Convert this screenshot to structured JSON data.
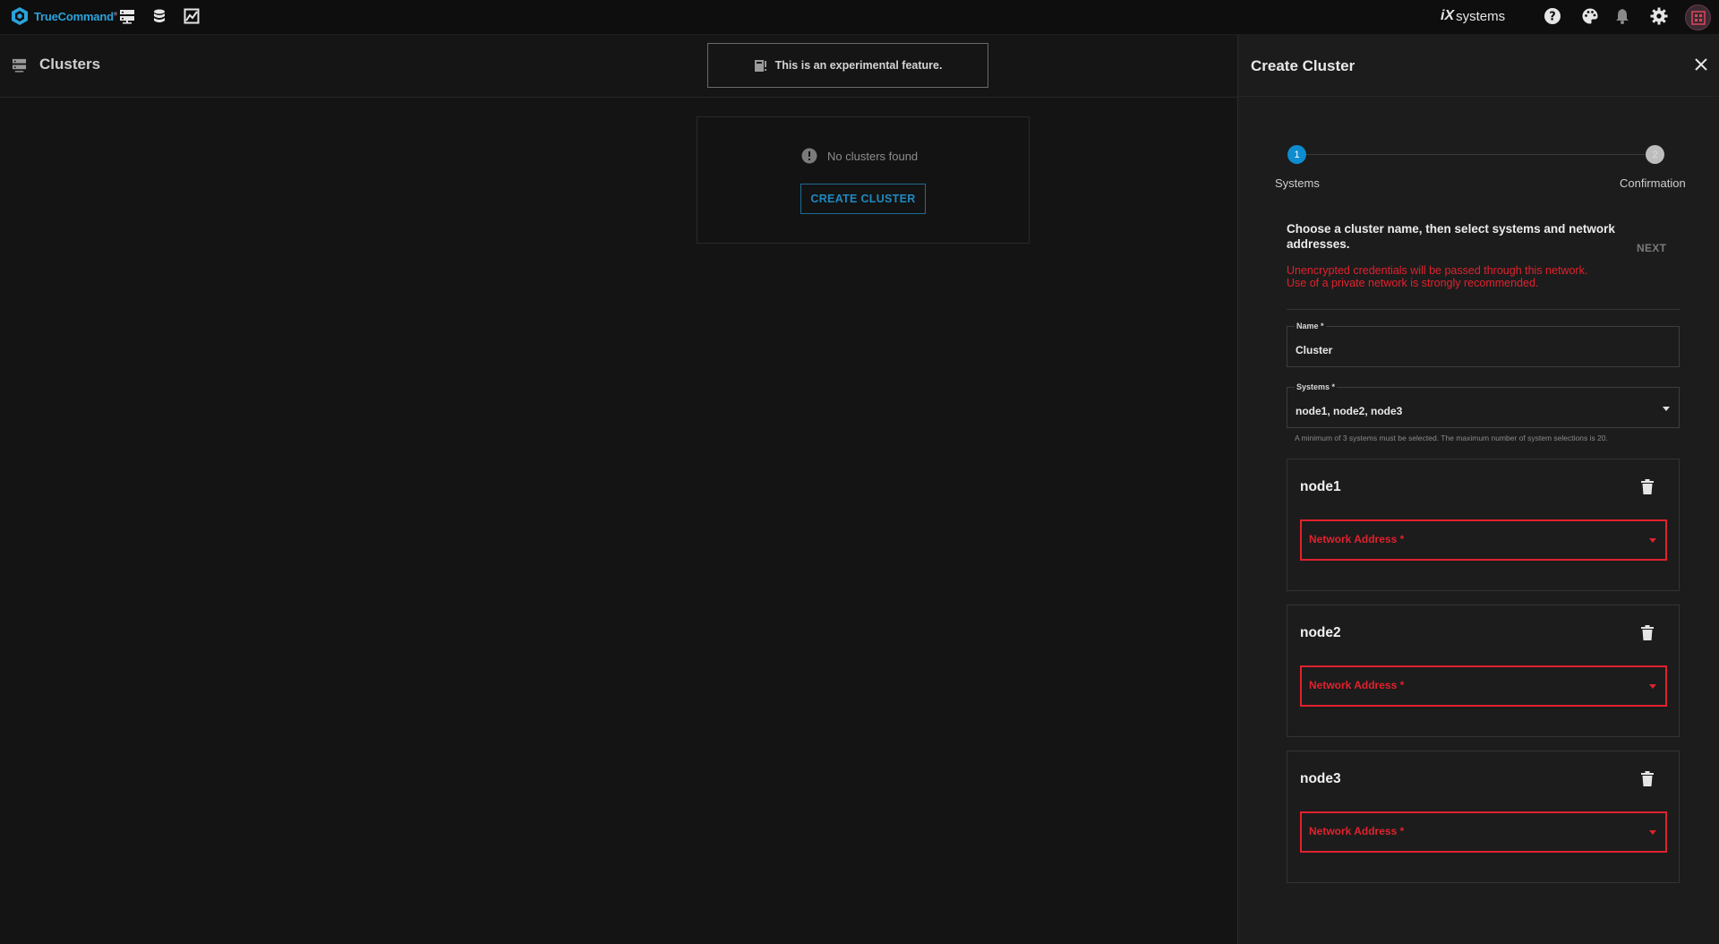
{
  "topbar": {
    "logo_text": "TrueCommand",
    "logo_mark": "®",
    "nav_icons": [
      "systems-icon",
      "database-icon",
      "chart-icon"
    ],
    "brand_prefix": "iX",
    "brand_text": "systems",
    "right_icons": [
      "help-icon",
      "palette-icon",
      "bell-icon",
      "gear-icon",
      "avatar-icon"
    ]
  },
  "page": {
    "title": "Clusters",
    "experimental_banner": "This is an experimental feature.",
    "empty_message": "No clusters found",
    "create_button": "CREATE CLUSTER"
  },
  "panel": {
    "title": "Create Cluster",
    "steps": [
      {
        "number": "1",
        "label": "Systems"
      },
      {
        "number": "2",
        "label": "Confirmation"
      }
    ],
    "instruction": "Choose a cluster name, then select systems and network addresses.",
    "next_label": "NEXT",
    "warning_line1": "Unencrypted credentials will be passed through this network.",
    "warning_line2": "Use of a private network is strongly recommended.",
    "name_field": {
      "label": "Name *",
      "value": "Cluster"
    },
    "systems_field": {
      "label": "Systems *",
      "value": "node1, node2, node3"
    },
    "systems_hint": "A minimum of 3 systems must be selected. The maximum number of system selections is 20.",
    "nodes": [
      {
        "name": "node1",
        "network_label": "Network Address *"
      },
      {
        "name": "node2",
        "network_label": "Network Address *"
      },
      {
        "name": "node3",
        "network_label": "Network Address *"
      }
    ]
  },
  "colors": {
    "accent": "#0d8cd0",
    "error": "#e0222e",
    "background": "#141414",
    "panel": "#1c1c1c"
  }
}
